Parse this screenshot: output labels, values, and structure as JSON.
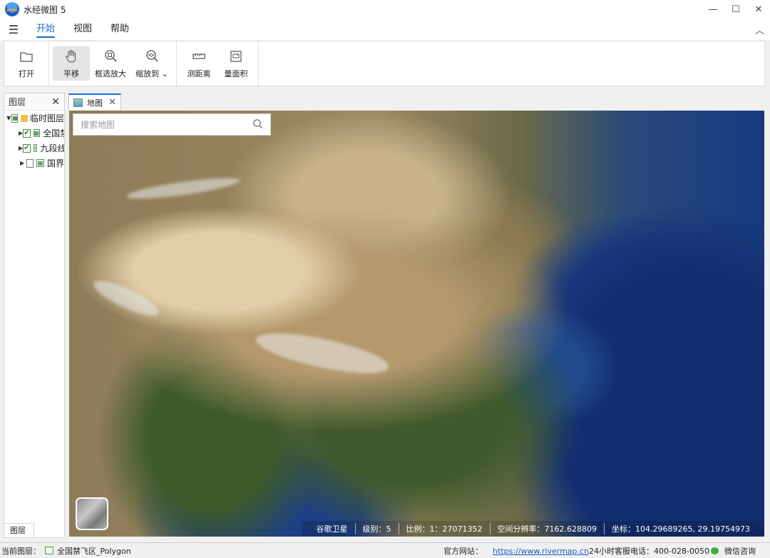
{
  "app": {
    "title": "水经微图 5"
  },
  "window_controls": {
    "minimize": "—",
    "maximize": "☐",
    "close": "✕"
  },
  "menu": {
    "tabs": [
      {
        "label": "开始",
        "active": true
      },
      {
        "label": "视图"
      },
      {
        "label": "帮助"
      }
    ]
  },
  "ribbon": {
    "open": "打开",
    "pan": "平移",
    "box_zoom": "框选放大",
    "zoom_to": "缩放到",
    "measure_distance": "测距离",
    "measure_area": "量面积"
  },
  "layer_panel": {
    "title": "图层",
    "bottom_tab": "图层",
    "items": [
      {
        "label": "临时图层",
        "checked": "partial",
        "icon": "folder-icon",
        "expanded": true
      },
      {
        "label": "全国禁飞区_Polygon",
        "checked": true,
        "icon": "polygon-layer-icon"
      },
      {
        "label": "九段线",
        "checked": true,
        "icon": "line-layer-icon"
      },
      {
        "label": "国界",
        "checked": false,
        "icon": "polygon-layer-icon"
      }
    ]
  },
  "doc_tab": {
    "label": "地图"
  },
  "map": {
    "search_placeholder": "搜索地图",
    "source": "谷歌卫星",
    "level": "级别：5",
    "scale": "比例：1：27071352",
    "resolution": "空间分辨率：7162.628809",
    "coordinates": "坐标：104.29689265, 29.19754973"
  },
  "statusbar": {
    "current_layer_label": "当前图层：",
    "current_layer": "全国禁飞区_Polygon",
    "website_label": "官方网站：",
    "website_url": "https://www.rivermap.cn",
    "hotline": "24小时客服电话：400-028-0050",
    "wechat": "微信咨询"
  },
  "colors": {
    "accent": "#1a6bd0",
    "ocean": "#173a80",
    "link": "#1a5fc4"
  }
}
